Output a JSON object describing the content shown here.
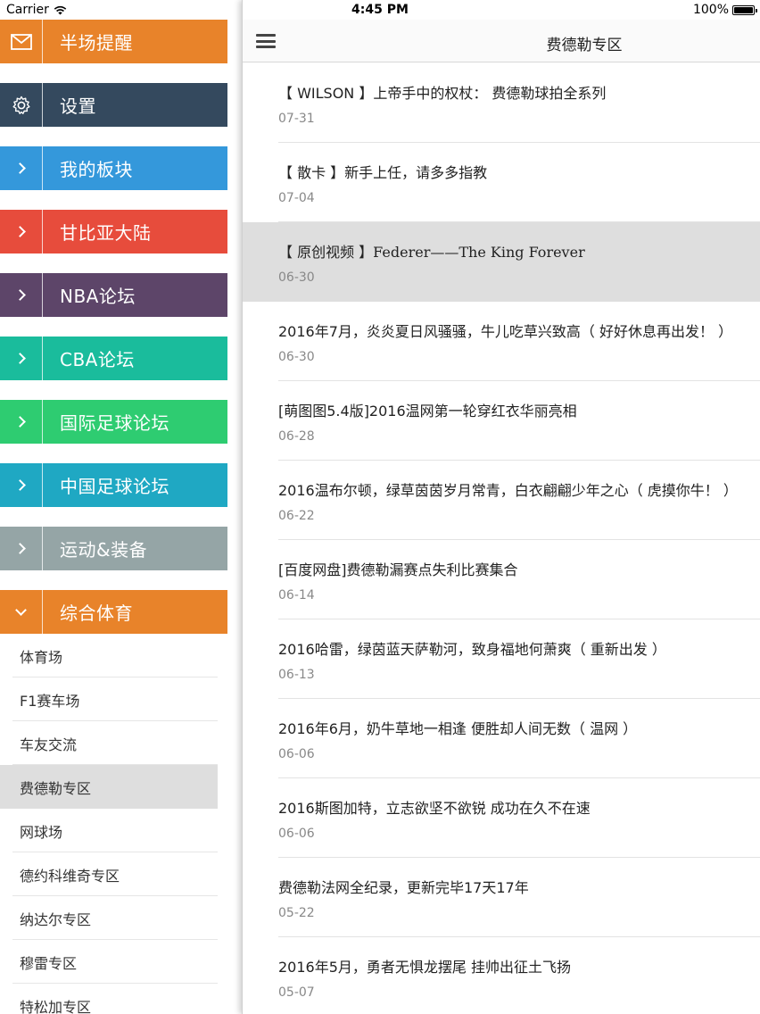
{
  "status_bar": {
    "carrier": "Carrier",
    "time": "4:45 PM",
    "battery": "100%"
  },
  "sidebar": {
    "categories": [
      {
        "label": "半场提醒",
        "icon": "mail-icon",
        "color": "#e8832a"
      },
      {
        "label": "设置",
        "icon": "gear-icon",
        "color": "#34495e"
      },
      {
        "label": "我的板块",
        "icon": "chevron-right-icon",
        "color": "#3498db"
      },
      {
        "label": "甘比亚大陆",
        "icon": "chevron-right-icon",
        "color": "#e74c3c"
      },
      {
        "label": "NBA论坛",
        "icon": "chevron-right-icon",
        "color": "#5d4569"
      },
      {
        "label": "CBA论坛",
        "icon": "chevron-right-icon",
        "color": "#1abc9c"
      },
      {
        "label": "国际足球论坛",
        "icon": "chevron-right-icon",
        "color": "#2ecc71"
      },
      {
        "label": "中国足球论坛",
        "icon": "chevron-right-icon",
        "color": "#1fa8c3"
      },
      {
        "label": "运动&装备",
        "icon": "chevron-right-icon",
        "color": "#95a5a6"
      },
      {
        "label": "综合体育",
        "icon": "chevron-down-icon",
        "color": "#e8832a"
      }
    ],
    "sub_items": [
      {
        "label": "体育场"
      },
      {
        "label": "F1赛车场"
      },
      {
        "label": "车友交流"
      },
      {
        "label": "费德勒专区",
        "selected": true
      },
      {
        "label": "网球场"
      },
      {
        "label": "德约科维奇专区"
      },
      {
        "label": "纳达尔专区"
      },
      {
        "label": "穆雷专区"
      },
      {
        "label": "特松加专区"
      }
    ]
  },
  "header": {
    "title": "费德勒专区",
    "menu_icon": "hamburger-menu-icon"
  },
  "threads": [
    {
      "title": "【 WILSON 】上帝手中的权杖： 费德勒球拍全系列",
      "date": "07-31"
    },
    {
      "title": "【 散卡 】新手上任，请多多指教",
      "date": "07-04"
    },
    {
      "title": "【 原创视频 】Federer——The King Forever",
      "date": "06-30",
      "selected": true
    },
    {
      "title": "2016年7月，炎炎夏日风骚骚，牛儿吃草兴致高（ 好好休息再出发！ ）",
      "date": "06-30"
    },
    {
      "title": "[萌图图5.4版]2016温网第一轮穿红衣华丽亮相",
      "date": "06-28"
    },
    {
      "title": "2016温布尔顿，绿草茵茵岁月常青，白衣翩翩少年之心（ 虎摸你牛！ ）",
      "date": "06-22"
    },
    {
      "title": "[百度网盘]费德勒漏赛点失利比赛集合",
      "date": "06-14"
    },
    {
      "title": "2016哈雷，绿茵蓝天萨勒河，致身福地何萧爽（ 重新出发 ）",
      "date": "06-13"
    },
    {
      "title": "2016年6月，奶牛草地一相逢 便胜却人间无数（ 温网 ）",
      "date": "06-06"
    },
    {
      "title": "2016斯图加特，立志欲坚不欲锐 成功在久不在速",
      "date": "06-06"
    },
    {
      "title": "费德勒法网全纪录，更新完毕17天17年",
      "date": "05-22"
    },
    {
      "title": "2016年5月，勇者无惧龙摆尾 挂帅出征土飞扬",
      "date": "05-07"
    }
  ]
}
